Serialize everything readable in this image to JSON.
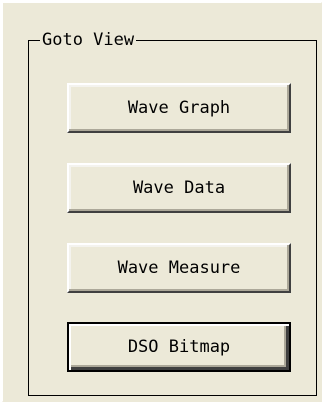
{
  "group": {
    "title": "Goto View"
  },
  "buttons": {
    "wave_graph": "Wave Graph",
    "wave_data": "Wave Data",
    "wave_measure": "Wave Measure",
    "dso_bitmap": "DSO Bitmap"
  }
}
